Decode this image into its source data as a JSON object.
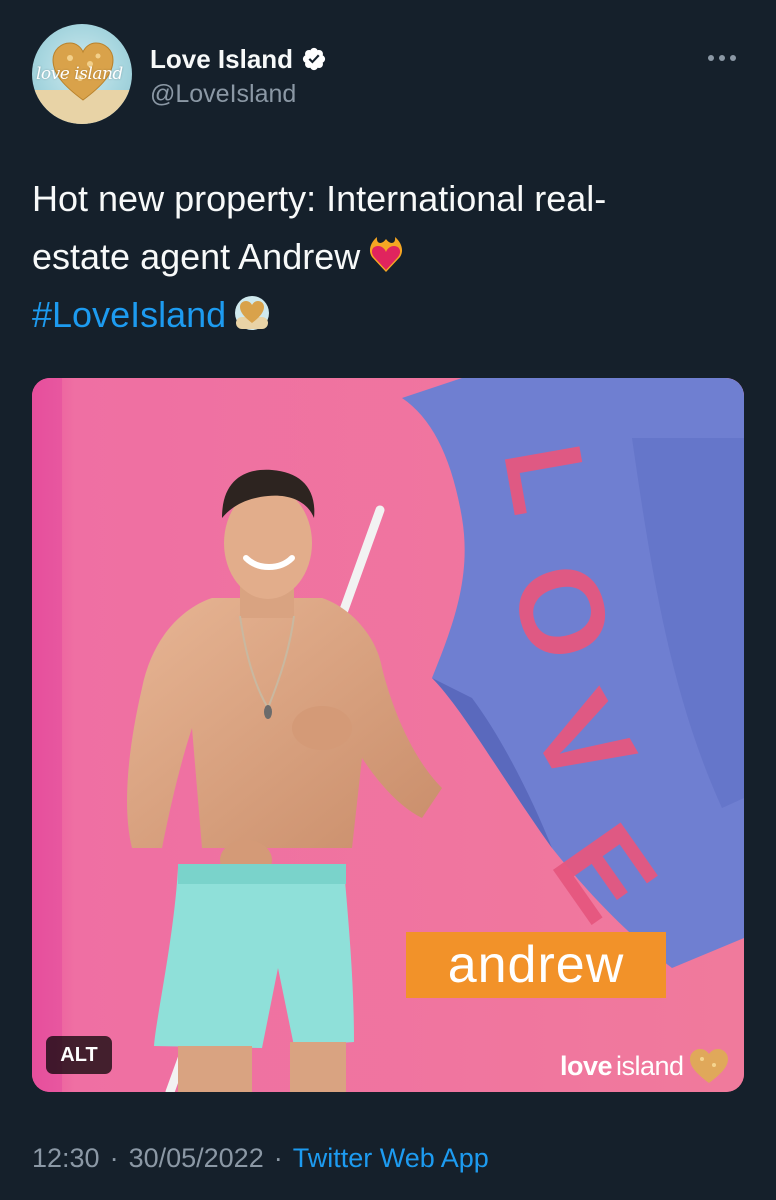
{
  "author": {
    "display_name": "Love Island",
    "handle": "@LoveIsland",
    "verified": true,
    "avatar_logo_text": "love island",
    "avatar_icon": "love-island-heart-logo"
  },
  "tweet": {
    "text_lines": [
      "Hot new property: International real-",
      "estate agent Andrew"
    ],
    "emoji_1": "heart-on-fire-emoji",
    "hashtag": "#LoveIsland",
    "emoji_2": "love-island-hashtag-emoji"
  },
  "media": {
    "alt_label": "ALT",
    "name_card": "andrew",
    "flag_text": "LOVE",
    "watermark_bold": "love",
    "watermark_rest": "island"
  },
  "footer": {
    "time": "12:30",
    "separator": "·",
    "date": "30/05/2022",
    "source": "Twitter Web App"
  },
  "colors": {
    "background": "#15202b",
    "text": "#f7f9f9",
    "muted": "#8b98a5",
    "link": "#1d9bf0",
    "verified_badge": "#ffffff",
    "photo_background": "#ec6c9c",
    "flag": "#6f7fd1",
    "name_card": "#f29229"
  }
}
